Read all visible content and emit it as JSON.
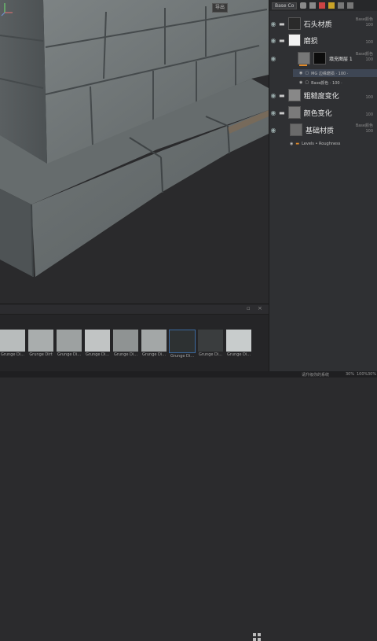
{
  "viewport": {
    "top_button": "导出"
  },
  "layers_panel": {
    "mode_label": "Base Co",
    "layers": [
      {
        "name": "石头材质",
        "meta_top": "Base颜色",
        "meta_bot": "100"
      },
      {
        "name": "磨损",
        "meta_top": "",
        "meta_bot": "100"
      },
      {
        "name": "填充图层 1",
        "meta_top": "Base颜色",
        "meta_bot": "100",
        "sub": true
      },
      {
        "name": "粗糙度变化",
        "meta_top": "",
        "meta_bot": "100"
      },
      {
        "name": "颜色变化",
        "meta_top": "",
        "meta_bot": "100"
      },
      {
        "name": "基础材质",
        "meta_top": "Base颜色",
        "meta_bot": "100"
      }
    ],
    "effect_rows": [
      {
        "label": "MG 边缘磨损 · 100 ·"
      },
      {
        "label": "Base颜色 · 100 ·"
      },
      {
        "label": "Levels • Roughness"
      }
    ]
  },
  "shelf": {
    "items": [
      {
        "label": "Grunge Di..."
      },
      {
        "label": "Grunge Dirt"
      },
      {
        "label": "Grunge Di..."
      },
      {
        "label": "Grunge Di..."
      },
      {
        "label": "Grunge Di..."
      },
      {
        "label": "Grunge Di..."
      },
      {
        "label": "Grunge Di..."
      },
      {
        "label": "Grunge Di..."
      },
      {
        "label": "Grunge Di..."
      }
    ]
  },
  "status": {
    "left": "",
    "msg": "请升级你的系统",
    "zoom": "30%",
    "num1": "100%",
    "num2": "30%"
  }
}
